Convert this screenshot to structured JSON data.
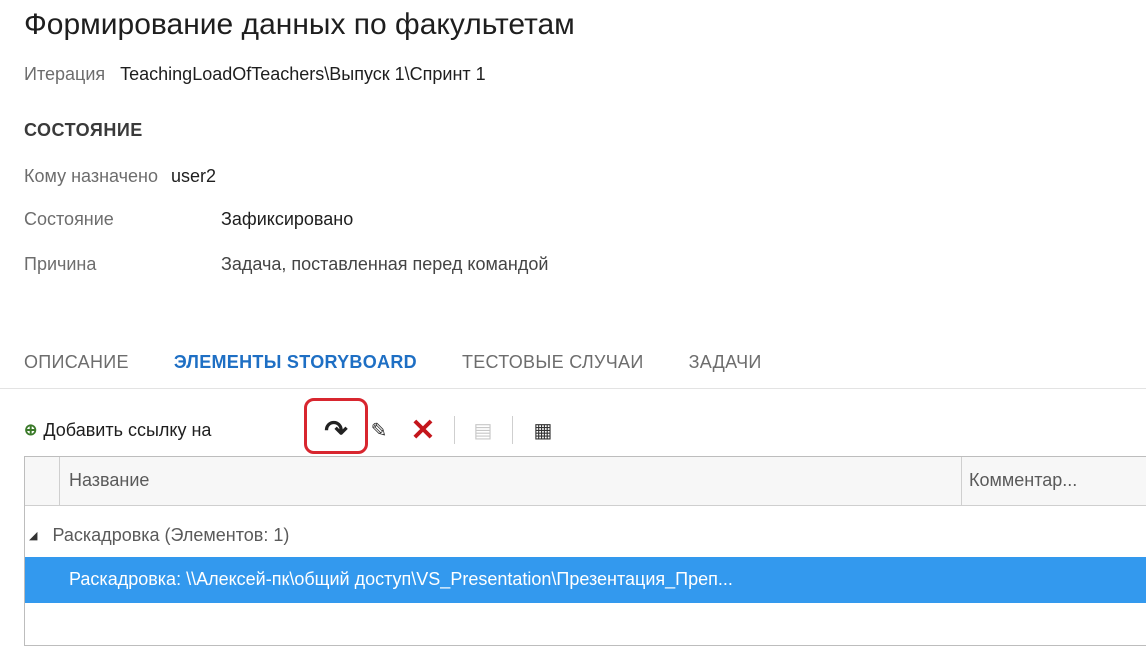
{
  "title": "Формирование данных по факультетам",
  "iteration": {
    "label": "Итерация",
    "value": "TeachingLoadOfTeachers\\Выпуск 1\\Спринт 1"
  },
  "state_section": {
    "title": "СОСТОЯНИЕ",
    "assigned_label": "Кому назначено",
    "assigned_value": "user2",
    "state_label": "Состояние",
    "state_value": "Зафиксировано",
    "reason_label": "Причина",
    "reason_value": "Задача, поставленная перед командой"
  },
  "tabs": [
    {
      "label": "ОПИСАНИЕ",
      "active": false
    },
    {
      "label": "ЭЛЕМЕНТЫ STORYBOARD",
      "active": true
    },
    {
      "label": "ТЕСТОВЫЕ СЛУЧАИ",
      "active": false
    },
    {
      "label": "ЗАДАЧИ",
      "active": false
    }
  ],
  "toolbar": {
    "add_link_label": "Добавить ссылку на",
    "icons": [
      "add-link-icon",
      "redo-icon",
      "edit-icon",
      "delete-icon",
      "document-icon",
      "grid-settings-icon"
    ],
    "accent_highlight": "#d8262f"
  },
  "grid": {
    "columns": [
      "Название",
      "Комментар..."
    ],
    "group": "Раскадровка (Элементов: 1)",
    "rows": [
      {
        "name": "Раскадровка: \\\\Алексей-пк\\общий доступ\\VS_Presentation\\Презентация_Преп...",
        "selected": true
      }
    ],
    "selected_color": "#3399ee"
  }
}
